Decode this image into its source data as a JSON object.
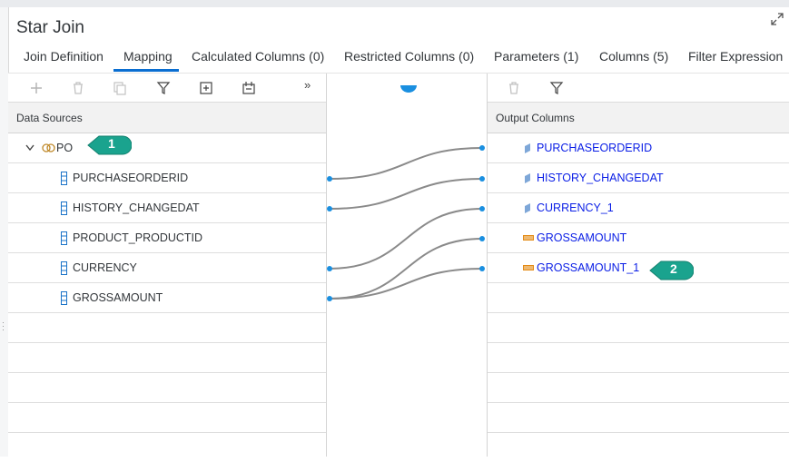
{
  "dialog": {
    "title": "Star Join"
  },
  "tabs": [
    {
      "label": "Join Definition"
    },
    {
      "label": "Mapping"
    },
    {
      "label": "Calculated Columns (0)"
    },
    {
      "label": "Restricted Columns (0)"
    },
    {
      "label": "Parameters (1)"
    },
    {
      "label": "Columns (5)"
    },
    {
      "label": "Filter Expression"
    }
  ],
  "active_tab": "Mapping",
  "left": {
    "header": "Data Sources",
    "overflow_glyph": "»",
    "source": {
      "name": "PO"
    },
    "columns": [
      {
        "label": "PURCHASEORDERID"
      },
      {
        "label": "HISTORY_CHANGEDAT"
      },
      {
        "label": "PRODUCT_PRODUCTID"
      },
      {
        "label": "CURRENCY"
      },
      {
        "label": "GROSSAMOUNT"
      }
    ]
  },
  "right": {
    "header": "Output Columns",
    "columns": [
      {
        "label": "PURCHASEORDERID",
        "icon": "attribute-icon"
      },
      {
        "label": "HISTORY_CHANGEDAT",
        "icon": "attribute-icon"
      },
      {
        "label": "CURRENCY_1",
        "icon": "attribute-icon"
      },
      {
        "label": "GROSSAMOUNT",
        "icon": "measure-icon"
      },
      {
        "label": "GROSSAMOUNT_1",
        "icon": "measure-icon"
      }
    ]
  },
  "callouts": [
    {
      "label": "1"
    },
    {
      "label": "2"
    }
  ],
  "colors": {
    "accent": "#0a6ed1",
    "callout": "#1aa38e",
    "link_text": "#0a1ee6",
    "connector": "#8a8a8a"
  }
}
